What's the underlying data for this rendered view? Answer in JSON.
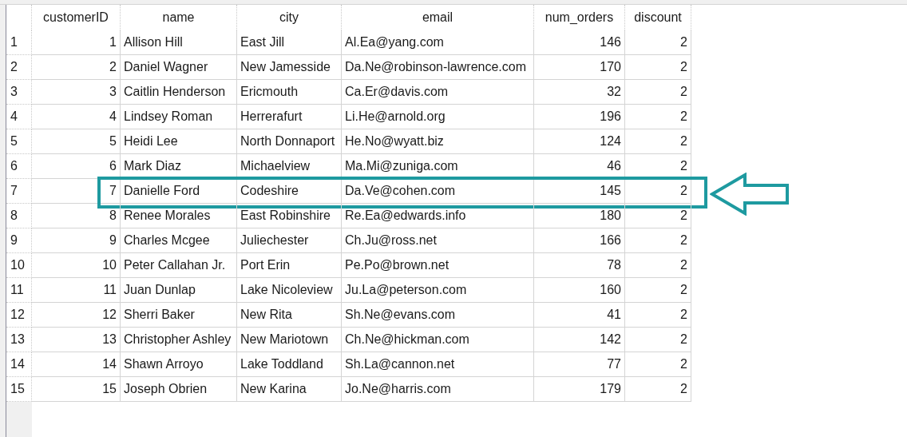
{
  "table": {
    "columns": [
      {
        "label": "customerID"
      },
      {
        "label": "name"
      },
      {
        "label": "city"
      },
      {
        "label": "email"
      },
      {
        "label": "num_orders"
      },
      {
        "label": "discount"
      }
    ],
    "rows": [
      {
        "number": "1",
        "cells": [
          "1",
          "Allison Hill",
          "East Jill",
          "Al.Ea@yang.com",
          "146",
          "2"
        ],
        "highlighted": false
      },
      {
        "number": "2",
        "cells": [
          "2",
          "Daniel Wagner",
          "New Jamesside",
          "Da.Ne@robinson-lawrence.com",
          "170",
          "2"
        ],
        "highlighted": false
      },
      {
        "number": "3",
        "cells": [
          "3",
          "Caitlin Henderson",
          "Ericmouth",
          "Ca.Er@davis.com",
          "32",
          "2"
        ],
        "highlighted": false
      },
      {
        "number": "4",
        "cells": [
          "4",
          "Lindsey Roman",
          "Herrerafurt",
          "Li.He@arnold.org",
          "196",
          "2"
        ],
        "highlighted": false
      },
      {
        "number": "5",
        "cells": [
          "5",
          "Heidi Lee",
          "North Donnaport",
          "He.No@wyatt.biz",
          "124",
          "2"
        ],
        "highlighted": false
      },
      {
        "number": "6",
        "cells": [
          "6",
          "Mark Diaz",
          "Michaelview",
          "Ma.Mi@zuniga.com",
          "46",
          "2"
        ],
        "highlighted": false
      },
      {
        "number": "7",
        "cells": [
          "7",
          "Danielle Ford",
          "Codeshire",
          "Da.Ve@cohen.com",
          "145",
          "2"
        ],
        "highlighted": true
      },
      {
        "number": "8",
        "cells": [
          "8",
          "Renee Morales",
          "East Robinshire",
          "Re.Ea@edwards.info",
          "180",
          "2"
        ],
        "highlighted": false
      },
      {
        "number": "9",
        "cells": [
          "9",
          "Charles Mcgee",
          "Juliechester",
          "Ch.Ju@ross.net",
          "166",
          "2"
        ],
        "highlighted": false
      },
      {
        "number": "10",
        "cells": [
          "10",
          "Peter Callahan Jr.",
          "Port Erin",
          "Pe.Po@brown.net",
          "78",
          "2"
        ],
        "highlighted": false
      },
      {
        "number": "11",
        "cells": [
          "11",
          "Juan Dunlap",
          "Lake Nicoleview",
          "Ju.La@peterson.com",
          "160",
          "2"
        ],
        "highlighted": false
      },
      {
        "number": "12",
        "cells": [
          "12",
          "Sherri Baker",
          "New Rita",
          "Sh.Ne@evans.com",
          "41",
          "2"
        ],
        "highlighted": false
      },
      {
        "number": "13",
        "cells": [
          "13",
          "Christopher Ashley",
          "New Mariotown",
          "Ch.Ne@hickman.com",
          "142",
          "2"
        ],
        "highlighted": false
      },
      {
        "number": "14",
        "cells": [
          "14",
          "Shawn Arroyo",
          "Lake Toddland",
          "Sh.La@cannon.net",
          "77",
          "2"
        ],
        "highlighted": false
      },
      {
        "number": "15",
        "cells": [
          "15",
          "Joseph Obrien",
          "New Karina",
          "Jo.Ne@harris.com",
          "179",
          "2"
        ],
        "highlighted": false
      }
    ]
  }
}
